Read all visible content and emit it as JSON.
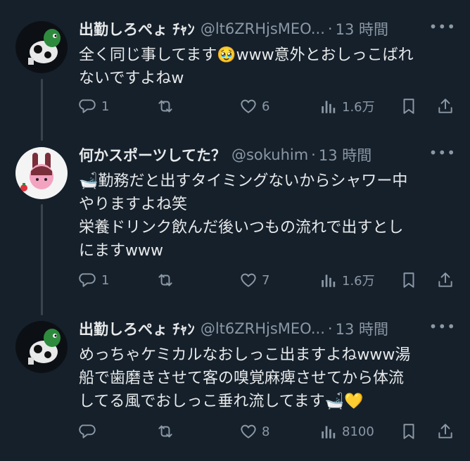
{
  "tweets": [
    {
      "name": "出勤しろぺょ ﾁｬﾝ",
      "handle": "@lt6ZRHjsMEO...",
      "time": "13 時間",
      "lines": [
        "全く同じ事してます🥹www意外とおしっこばれ",
        "ないですよねw"
      ],
      "replies": "1",
      "retweets": "",
      "likes": "6",
      "views": "1.6万"
    },
    {
      "name": "何かスポーツしてた？",
      "handle": "@sokuhim",
      "time": "13 時間",
      "lines": [
        "🛁勤務だと出すタイミングないからシャワー中",
        "やりますよね笑",
        "栄養ドリンク飲んだ後いつもの流れで出すとし",
        "にますwww"
      ],
      "replies": "1",
      "retweets": "",
      "likes": "7",
      "views": "1.6万"
    },
    {
      "name": "出勤しろぺょ ﾁｬﾝ",
      "handle": "@lt6ZRHjsMEO...",
      "time": "13 時間",
      "lines": [
        "めっちゃケミカルなおしっこ出ますよねwww湯",
        "船で歯磨きさせて客の嗅覚麻痺させてから体流",
        "してる風でおしっこ垂れ流してます🛁💛"
      ],
      "replies": "",
      "retweets": "",
      "likes": "8",
      "views": "8100"
    }
  ],
  "dot": "·",
  "more": "•••",
  "icons": [
    "reply-icon",
    "retweet-icon",
    "like-icon",
    "views-icon",
    "bookmark-icon",
    "share-icon"
  ],
  "colors": {
    "background": "#15202b",
    "text": "#e7e9ea",
    "muted": "#8b98a5"
  }
}
